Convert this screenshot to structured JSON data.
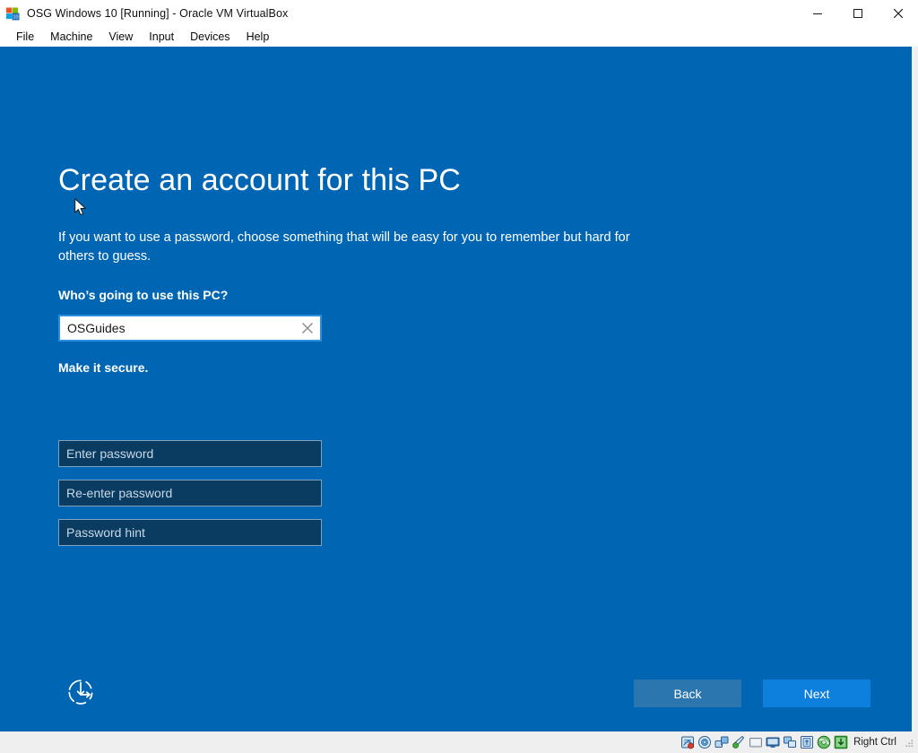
{
  "window": {
    "title": "OSG Windows 10 [Running] - Oracle VM VirtualBox",
    "app_icon": "windows10-vm-icon",
    "controls": {
      "minimize": "minimize-icon",
      "maximize": "maximize-icon",
      "close": "close-icon"
    }
  },
  "menubar": {
    "items": [
      {
        "label": "File"
      },
      {
        "label": "Machine"
      },
      {
        "label": "View"
      },
      {
        "label": "Input"
      },
      {
        "label": "Devices"
      },
      {
        "label": "Help"
      }
    ]
  },
  "oobe": {
    "heading": "Create an account for this PC",
    "subtext": "If you want to use a password, choose something that will be easy for you to remember but hard for others to guess.",
    "name_label": "Who’s going to use this PC?",
    "name_value": "OSGuides",
    "clear_icon": "clear-x-icon",
    "secure_label": "Make it secure.",
    "password_placeholder": "Enter password",
    "reenter_placeholder": "Re-enter password",
    "hint_placeholder": "Password hint",
    "ease_of_access_icon": "ease-of-access-icon",
    "back_label": "Back",
    "next_label": "Next",
    "colors": {
      "background": "#0066b4",
      "field_fill": "#0a3b61",
      "field_border": "#7fa3c0",
      "name_focus_border": "#2a8fe0",
      "back_button": "#2b76ae",
      "next_button": "#0d7fdc"
    }
  },
  "statusbar": {
    "icons": [
      {
        "name": "hard-disk-icon"
      },
      {
        "name": "optical-disk-icon"
      },
      {
        "name": "floppy-disk-icon"
      },
      {
        "name": "audio-icon"
      },
      {
        "name": "network-icon"
      },
      {
        "name": "display-icon"
      },
      {
        "name": "shared-folders-icon"
      },
      {
        "name": "usb-icon"
      },
      {
        "name": "recording-icon"
      },
      {
        "name": "mouse-integration-icon"
      }
    ],
    "host_key": "Right Ctrl",
    "grip": "resize-grip-icon"
  }
}
